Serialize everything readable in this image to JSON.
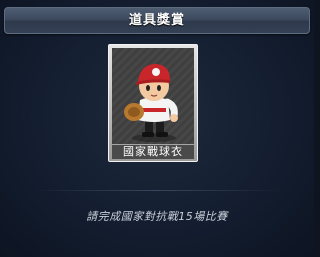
{
  "panel": {
    "title": "道具獎賞"
  },
  "reward": {
    "item_name": "國家戰球衣",
    "icon": "baseball-player-uniform-icon"
  },
  "requirement": {
    "text": "請完成國家對抗戰15場比賽"
  },
  "colors": {
    "title_bar": "#3a475b",
    "panel_bg": "#152033",
    "caption_bg": "#4a4a4a",
    "jersey_red": "#c8262a"
  }
}
